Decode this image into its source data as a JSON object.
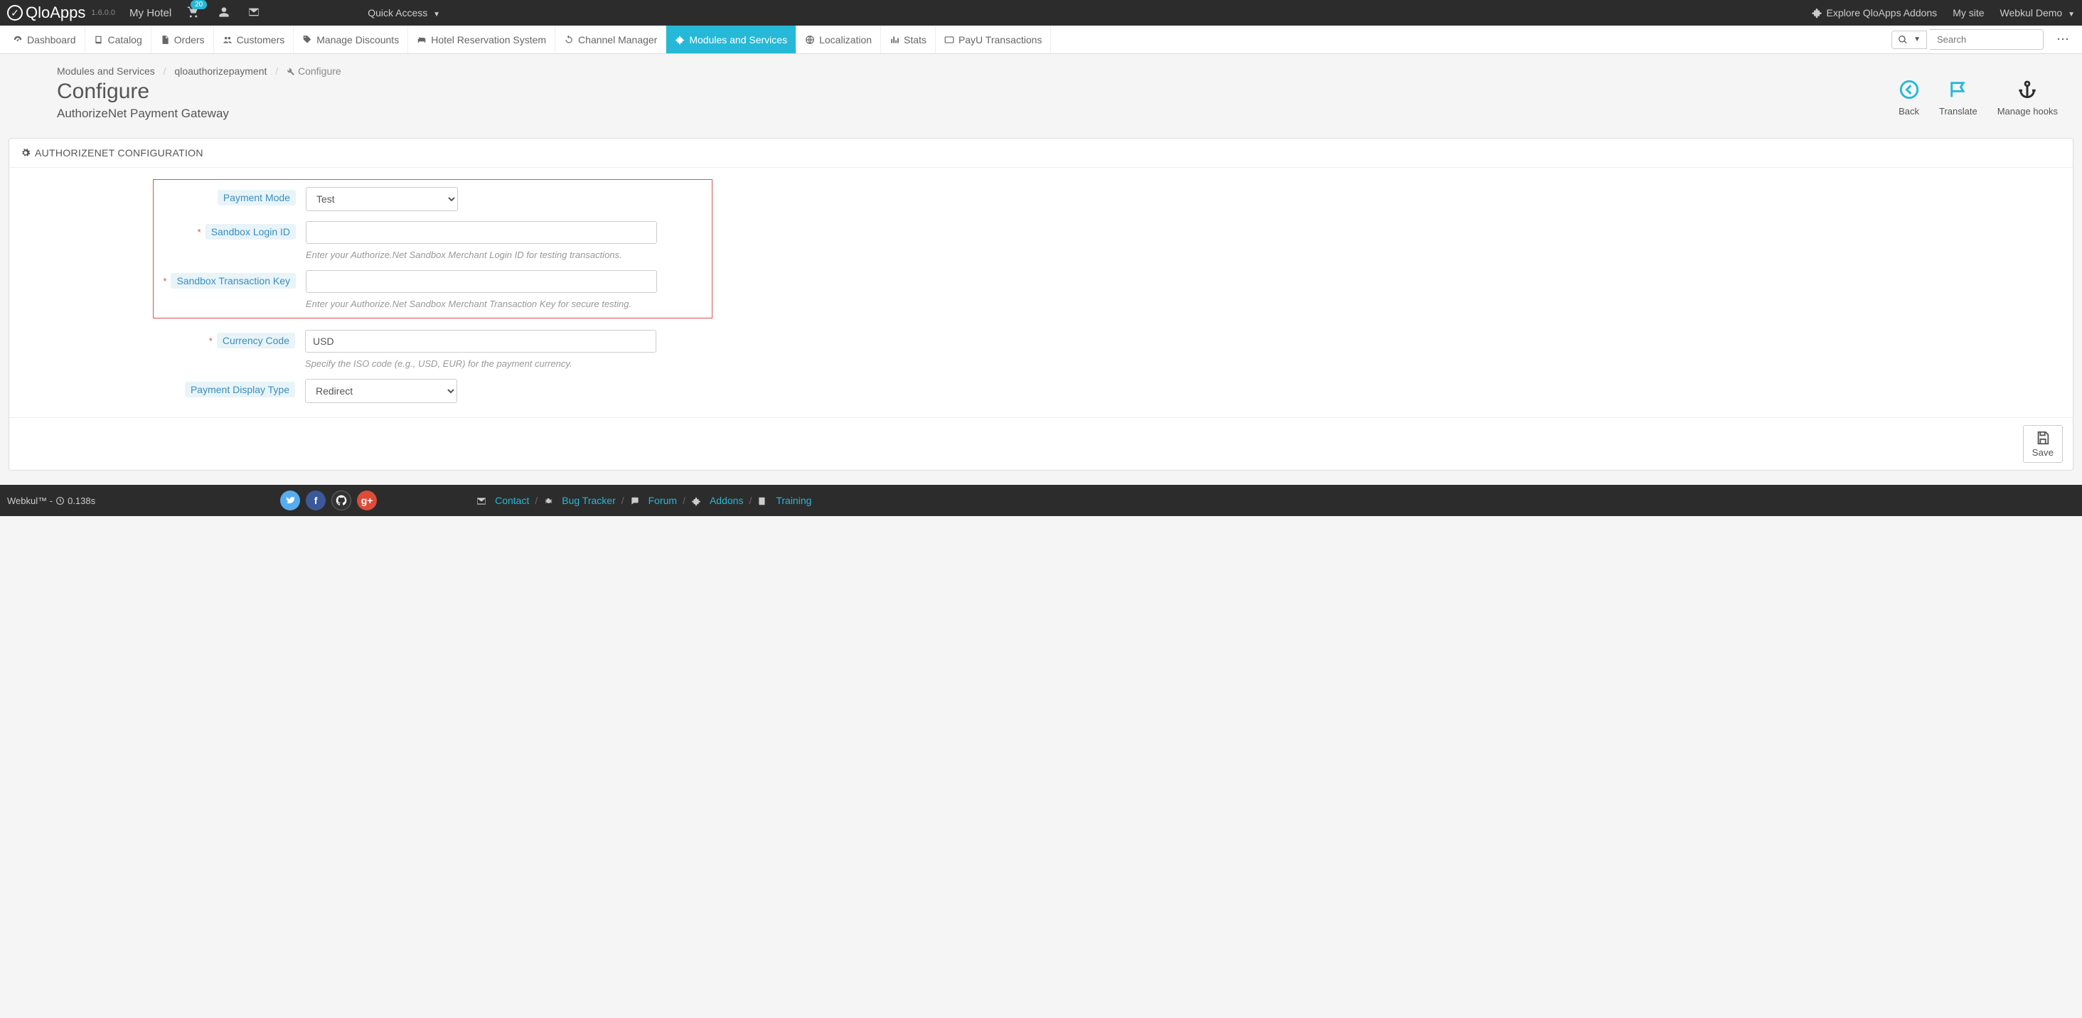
{
  "topbar": {
    "brand": "QloApps",
    "version": "1.6.0.0",
    "hotel": "My Hotel",
    "cart_count": "20",
    "quick_access": "Quick Access",
    "explore": "Explore QloApps Addons",
    "mysite": "My site",
    "user": "Webkul Demo"
  },
  "menu": {
    "dashboard": "Dashboard",
    "catalog": "Catalog",
    "orders": "Orders",
    "customers": "Customers",
    "discounts": "Manage Discounts",
    "hotel": "Hotel Reservation System",
    "channel": "Channel Manager",
    "modules": "Modules and Services",
    "localization": "Localization",
    "stats": "Stats",
    "payu": "PayU Transactions",
    "search_placeholder": "Search"
  },
  "breadcrumb": {
    "a": "Modules and Services",
    "b": "qloauthorizepayment",
    "c": "Configure"
  },
  "page": {
    "title": "Configure",
    "subtitle": "AuthorizeNet Payment Gateway"
  },
  "actions": {
    "back": "Back",
    "translate": "Translate",
    "hooks": "Manage hooks"
  },
  "panel": {
    "heading": "AUTHORIZENET CONFIGURATION",
    "save": "Save"
  },
  "form": {
    "payment_mode": {
      "label": "Payment Mode",
      "value": "Test"
    },
    "sandbox_login": {
      "label": "Sandbox Login ID",
      "help": "Enter your Authorize.Net Sandbox Merchant Login ID for testing transactions."
    },
    "sandbox_key": {
      "label": "Sandbox Transaction Key",
      "help": "Enter your Authorize.Net Sandbox Merchant Transaction Key for secure testing."
    },
    "currency": {
      "label": "Currency Code",
      "value": "USD",
      "help": "Specify the ISO code (e.g., USD, EUR) for the payment currency."
    },
    "display_type": {
      "label": "Payment Display Type",
      "value": "Redirect"
    }
  },
  "footer": {
    "brand": "Webkul™ - ",
    "time": "0.138s",
    "contact": "Contact",
    "bug": "Bug Tracker",
    "forum": "Forum",
    "addons": "Addons",
    "training": "Training"
  }
}
